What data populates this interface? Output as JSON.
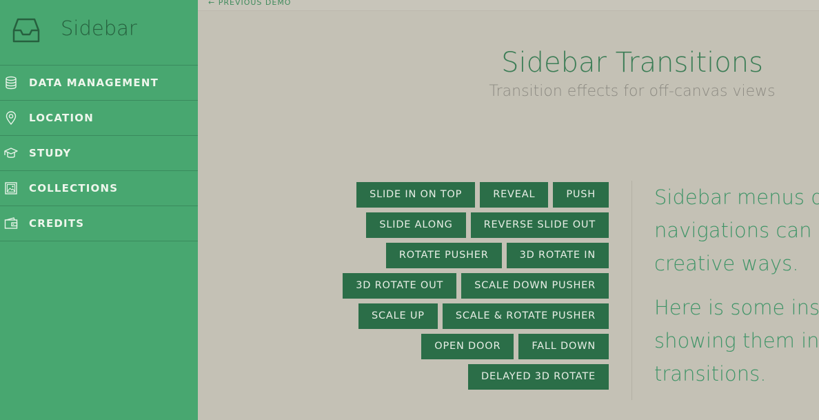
{
  "sidebar": {
    "title": "Sidebar",
    "items": [
      {
        "label": "DATA MANAGEMENT",
        "icon": "database-icon"
      },
      {
        "label": "LOCATION",
        "icon": "location-pin-icon"
      },
      {
        "label": "STUDY",
        "icon": "graduation-cap-icon"
      },
      {
        "label": "COLLECTIONS",
        "icon": "image-icon"
      },
      {
        "label": "CREDITS",
        "icon": "wallet-icon"
      }
    ]
  },
  "topbar": {
    "prev_demo": "← PREVIOUS DEMO"
  },
  "header": {
    "title": "Sidebar Transitions",
    "subtitle": "Transition effects for off-canvas views"
  },
  "buttons": {
    "slide_in_on_top": "SLIDE IN ON TOP",
    "reveal": "REVEAL",
    "push": "PUSH",
    "slide_along": "SLIDE ALONG",
    "reverse_slide_out": "REVERSE SLIDE OUT",
    "rotate_pusher": "ROTATE PUSHER",
    "rotate_in_3d": "3D ROTATE IN",
    "rotate_out_3d": "3D ROTATE OUT",
    "scale_down_pusher": "SCALE DOWN PUSHER",
    "scale_up": "SCALE UP",
    "scale_rotate_pusher": "SCALE & ROTATE PUSHER",
    "open_door": "OPEN DOOR",
    "fall_down": "FALL DOWN",
    "delayed_3d_rotate": "DELAYED 3D ROTATE"
  },
  "info": {
    "paragraph1": "Sidebar menus or\nnavigations can be\ncreative ways.",
    "paragraph2": "Here is some insp\nshowing them in s\ntransitions."
  },
  "colors": {
    "sidebar_bg": "#48a770",
    "main_bg": "#c4c1b5",
    "button_bg": "#2b6e48",
    "accent": "#3c7d56"
  }
}
